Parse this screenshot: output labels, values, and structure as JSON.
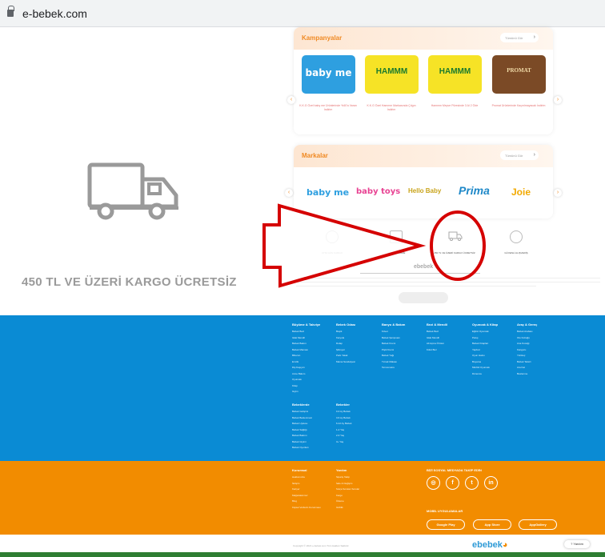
{
  "browser": {
    "url": "e-bebek.com"
  },
  "feature_zoom": {
    "label": "450 TL VE ÜZERİ KARGO ÜCRETSİZ"
  },
  "campaigns": {
    "title": "Kampanyalar",
    "view_all": "Tümünü Gör",
    "items": [
      {
        "logo": "baby me",
        "caption": "K.K.G Özel baby me Ürünlerinde %40'a Varan İndirim",
        "bg": "#2e9fe0"
      },
      {
        "logo": "HAMMM",
        "caption": "K.K.G Özel Hammm Markasında Çılgın İndirim",
        "bg": "#f6e326"
      },
      {
        "logo": "HAMMM",
        "caption": "Hammm Meyve Püresinde 3 Al 2 Öde",
        "bg": "#f6e326"
      },
      {
        "logo": "PROMAT",
        "caption": "Promat Ürünlerinde Kaçırılmayacak İndirim",
        "bg": "#7b4a26"
      }
    ]
  },
  "brands": {
    "title": "Markalar",
    "view_all": "Tümünü Gör",
    "items": [
      "baby me",
      "baby toys",
      "Hello Baby",
      "Prima",
      "Joie"
    ]
  },
  "features": [
    "AYNI GÜN KARGO",
    "ÜCRETSİZ İADE",
    "450 TL VE ÜZERİ KARGO ÜCRETSİZ",
    "GÜVENLİ ALIŞVERİŞ"
  ],
  "footer_links": {
    "columns": [
      {
        "title": "Büyüme & Takviye",
        "items": [
          "Bebek Bezi",
          "Islak Mendil",
          "Bebek Bakım",
          "Bebek Maması",
          "Biberon",
          "Emzik",
          "Diş Kaşıyıcı",
          "Anne Bakım",
          "Oyuncak",
          "Kitap",
          "Giyim"
        ]
      },
      {
        "title": "Bebek Odası",
        "items": [
          "Beşik",
          "Karyola",
          "Dolap",
          "Şifonyer",
          "Park Yatak",
          "Mama Sandalyesi"
        ]
      },
      {
        "title": "Banyo & Bakım",
        "items": [
          "Küvet",
          "Bebek Şampuanı",
          "Bebek Kremi",
          "Pişik Kremi",
          "Bebek Yağı",
          "Tırnak Makası",
          "Termometre"
        ]
      },
      {
        "title": "Bezi & Mendil",
        "items": [
          "Bebek Bezi",
          "Islak Mendil",
          "Alt Açma Örtüsü",
          "Külot Bez"
        ]
      },
      {
        "title": "Oyuncak & Kitap",
        "items": [
          "Eğitici Oyuncak",
          "Peluş",
          "Bebek Kitapları",
          "Yapboz",
          "Oyun Halısı",
          "Boyama",
          "Müzikli Oyuncak",
          "Dönence"
        ]
      },
      {
        "title": "Araç & Gereç",
        "items": [
          "Bebek Arabası",
          "Oto Koltuğu",
          "Ana Kucağı",
          "Kanguru",
          "Yürüteç",
          "Bebek Telsizi",
          "Ara Kat",
          "Beslenme"
        ]
      },
      {
        "title": "Bebeklerde",
        "items": [
          "Bebek Gelişimi",
          "Bebek Beslenmesi",
          "Bebek Uykusu",
          "Bebek Sağlığı",
          "Bebek Bakımı",
          "Bebek Giyimi",
          "Bebek Oyunları"
        ]
      },
      {
        "title": "Bebekler",
        "items": [
          "0-3 Ay Bebek",
          "3-6 Ay Bebek",
          "6-12 Ay Bebek",
          "1-2 Yaş",
          "2-3 Yaş",
          "3+ Yaş"
        ]
      }
    ]
  },
  "footer_orange": {
    "col1": {
      "title": "Kurumsal",
      "items": [
        "Hakkımızda",
        "İletişim",
        "Kariyer",
        "Mağazalarımız",
        "Blog",
        "Kişisel Verilerin Korunması"
      ]
    },
    "col2": {
      "title": "Yardım",
      "items": [
        "Sipariş Takip",
        "İade & Değişim",
        "Sıkça Sorulan Sorular",
        "Kargo",
        "Ödeme",
        "Gizlilik"
      ]
    },
    "social_title": "BİZİ SOSYAL MEDYADA TAKİP EDİN",
    "social": [
      "instagram",
      "facebook",
      "twitter",
      "linkedin"
    ],
    "apps_title": "MOBİL UYGULAMALAR",
    "stores": [
      "Google Play",
      "App Store",
      "AppGallery"
    ]
  },
  "bottom": {
    "copyright": "Copyright © 2021 e-bebek.com Tüm Hakları Saklıdır.",
    "logo_main": "ebebek",
    "help": "Yardım"
  },
  "colors": {
    "footer_blue": "#0a8bd4",
    "footer_orange": "#f28c00",
    "annotation_red": "#d50000"
  }
}
